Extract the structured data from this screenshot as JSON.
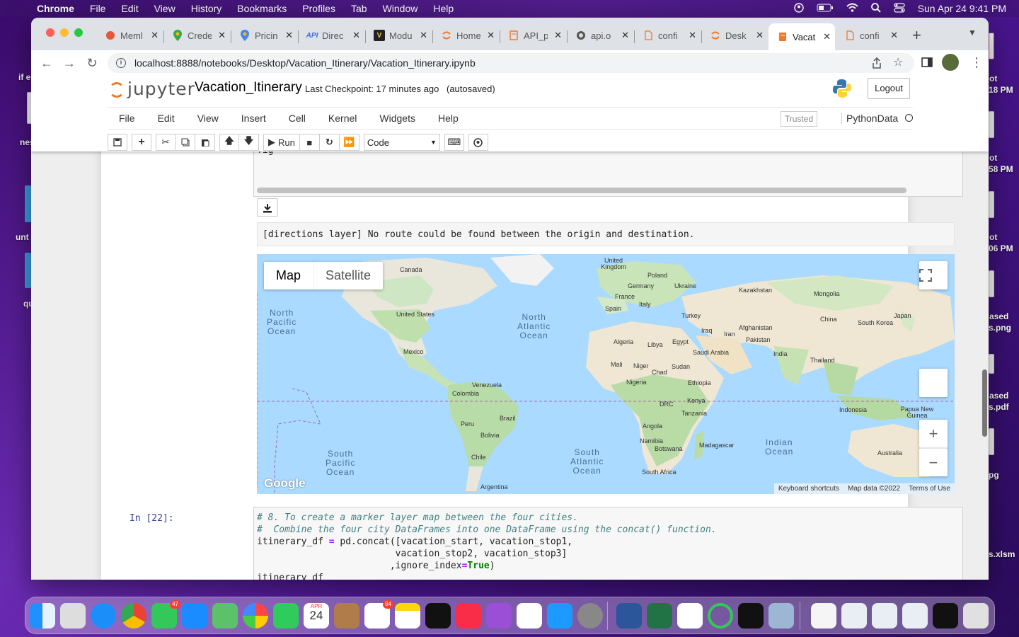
{
  "menubar": {
    "app": "Chrome",
    "items": [
      "File",
      "Edit",
      "View",
      "History",
      "Bookmarks",
      "Profiles",
      "Tab",
      "Window",
      "Help"
    ],
    "datetime": "Sun Apr 24  9:41 PM"
  },
  "desktop": {
    "left_labels": [
      "if e",
      "nes",
      "unt",
      "qu"
    ],
    "right_labels": [
      "ot",
      "18 PM",
      "ot",
      "58 PM",
      "ot",
      "06 PM",
      "ased",
      "s.png",
      "ased",
      "s.pdf",
      "pg",
      "s.xlsm"
    ]
  },
  "browser": {
    "tabs": [
      {
        "title": "Meml",
        "icon": "mem-icon"
      },
      {
        "title": "Crede",
        "icon": "google-maps-icon"
      },
      {
        "title": "Pricin",
        "icon": "google-maps-icon"
      },
      {
        "title": "Direc",
        "icon": "api-icon"
      },
      {
        "title": "Modu",
        "icon": "module-icon"
      },
      {
        "title": "Home",
        "icon": "jupyter-icon"
      },
      {
        "title": "API_p",
        "icon": "notebook-icon"
      },
      {
        "title": "api.o",
        "icon": "globe-icon"
      },
      {
        "title": "confi",
        "icon": "file-icon"
      },
      {
        "title": "Desk",
        "icon": "jupyter-icon"
      },
      {
        "title": "Vacat",
        "icon": "notebook-icon",
        "active": true
      },
      {
        "title": "confi",
        "icon": "file-icon"
      }
    ],
    "url": "localhost:8888/notebooks/Desktop/Vacation_Itinerary/Vacation_Itinerary.ipynb"
  },
  "jupyter": {
    "logo_text": "jupyter",
    "notebook_title": "Vacation_Itinerary",
    "checkpoint": "Last Checkpoint: 17 minutes ago",
    "autosave": "(autosaved)",
    "logout": "Logout",
    "menu": [
      "File",
      "Edit",
      "View",
      "Insert",
      "Cell",
      "Kernel",
      "Widgets",
      "Help"
    ],
    "trusted": "Trusted",
    "kernel": "PythonData",
    "run_label": "Run",
    "cell_type": "Code"
  },
  "cells": {
    "prev_output_code": "fig",
    "error_message": "[directions layer] No route could be found between the origin and destination.",
    "next_prompt": "In [22]:",
    "next_code": {
      "line1": "# 8. To create a marker layer map between the four cities.",
      "line2": "#  Combine the four city DataFrames into one DataFrame using the concat() function.",
      "line3a": "itinerary_df ",
      "line3b": "=",
      "line3c": " pd.concat([vacation_start, vacation_stop1,",
      "line4": "                         vacation_stop2, vacation_stop3]",
      "line5a": "                        ,ignore_index",
      "line5b": "=",
      "line5c": "True",
      "line5d": ")",
      "line6": "itinerary_df"
    }
  },
  "map": {
    "map_type_buttons": [
      "Map",
      "Satellite"
    ],
    "oceans": [
      {
        "name": "North\nPacific\nOcean"
      },
      {
        "name": "North\nAtlantic\nOcean"
      },
      {
        "name": "South\nPacific\nOcean"
      },
      {
        "name": "South\nAtlantic\nOcean"
      },
      {
        "name": "Indian\nOcean"
      }
    ],
    "places": [
      "Canada",
      "United States",
      "Mexico",
      "Venezuela",
      "Colombia",
      "Peru",
      "Brazil",
      "Bolivia",
      "Chile",
      "Argentina",
      "United Kingdom",
      "Poland",
      "Germany",
      "Ukraine",
      "France",
      "Italy",
      "Spain",
      "Kazakhstan",
      "Mongolia",
      "Turkey",
      "Iraq",
      "Iran",
      "Afghanistan",
      "China",
      "Japan",
      "South Korea",
      "Pakistan",
      "India",
      "Thailand",
      "Algeria",
      "Libya",
      "Egypt",
      "Saudi Arabia",
      "Mali",
      "Niger",
      "Chad",
      "Sudan",
      "Nigeria",
      "Ethiopia",
      "DRC",
      "Kenya",
      "Tanzania",
      "Angola",
      "Namibia",
      "Botswana",
      "Madagascar",
      "South Africa",
      "Indonesia",
      "Papua New Guinea",
      "Australia"
    ],
    "attribution": [
      "Keyboard shortcuts",
      "Map data ©2022",
      "Terms of Use"
    ],
    "logo": "Google"
  },
  "dock": {
    "calendar_month": "APR",
    "calendar_day": "24",
    "messages_badge": "47",
    "reminders_badge": "84"
  }
}
